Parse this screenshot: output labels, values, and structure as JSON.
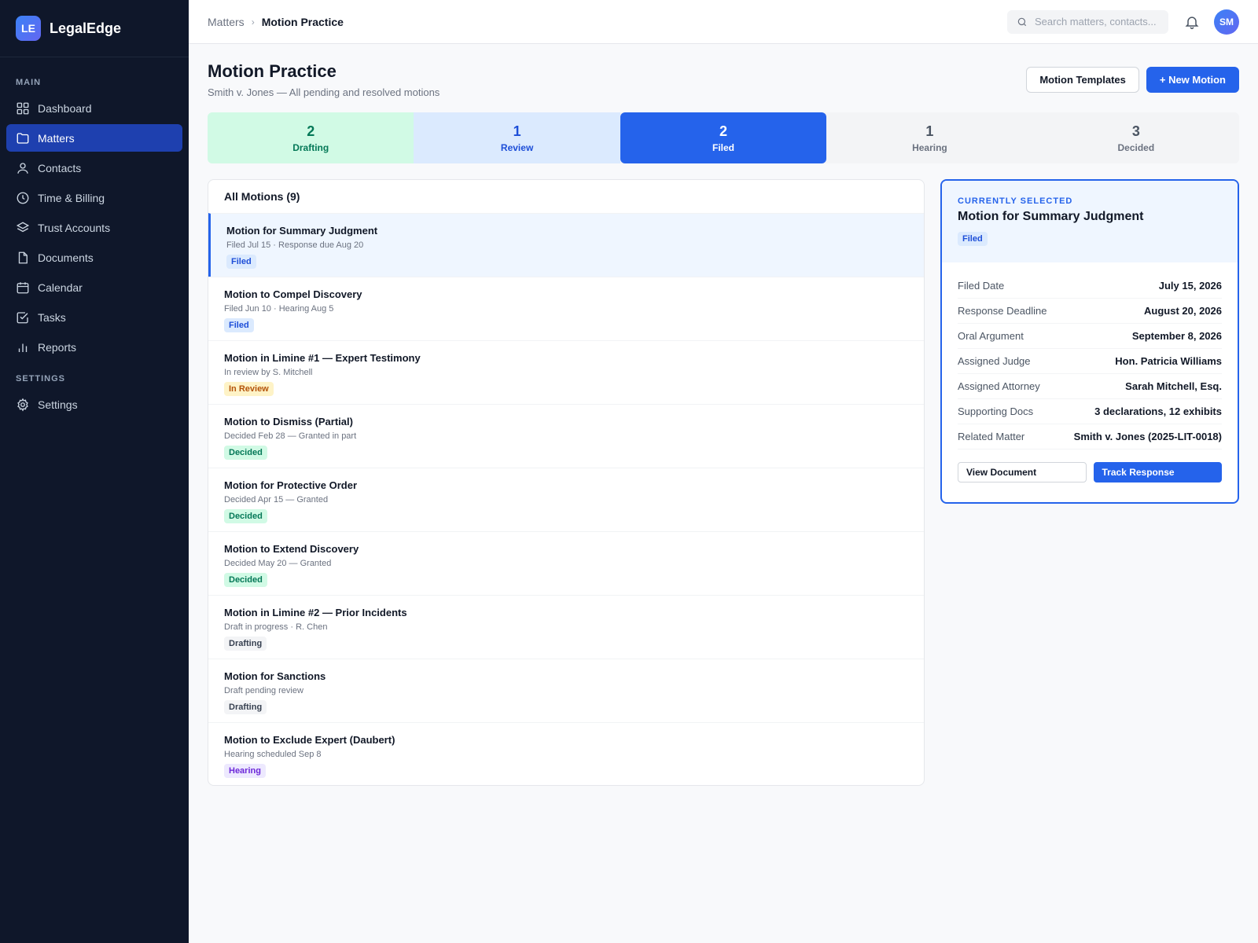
{
  "brand": {
    "logo": "LE",
    "name": "LegalEdge"
  },
  "sidebar": {
    "main_label": "MAIN",
    "items": [
      {
        "label": "Dashboard",
        "icon": "dashboard-icon"
      },
      {
        "label": "Matters",
        "icon": "folder-icon",
        "active": true
      },
      {
        "label": "Contacts",
        "icon": "user-icon"
      },
      {
        "label": "Time & Billing",
        "icon": "clock-icon"
      },
      {
        "label": "Trust Accounts",
        "icon": "layers-icon"
      },
      {
        "label": "Documents",
        "icon": "document-icon"
      },
      {
        "label": "Calendar",
        "icon": "calendar-icon"
      },
      {
        "label": "Tasks",
        "icon": "checkbox-icon"
      },
      {
        "label": "Reports",
        "icon": "bar-chart-icon"
      }
    ],
    "settings_label": "SETTINGS",
    "settings_item": {
      "label": "Settings",
      "icon": "gear-icon"
    }
  },
  "topbar": {
    "breadcrumb_parent": "Matters",
    "breadcrumb_current": "Motion Practice",
    "search_placeholder": "Search matters, contacts...",
    "avatar_initials": "SM"
  },
  "page": {
    "title": "Motion Practice",
    "subtitle": "Smith v. Jones — All pending and resolved motions",
    "templates_button": "Motion Templates",
    "new_button": "+ New Motion"
  },
  "stages": [
    {
      "count": "2",
      "label": "Drafting"
    },
    {
      "count": "1",
      "label": "Review"
    },
    {
      "count": "2",
      "label": "Filed",
      "selected": true
    },
    {
      "count": "1",
      "label": "Hearing"
    },
    {
      "count": "3",
      "label": "Decided"
    }
  ],
  "list": {
    "heading": "All Motions (9)",
    "motions": [
      {
        "title": "Motion for Summary Judgment",
        "detail": "Filed Jul 15 · Response due Aug 20",
        "status": "Filed",
        "selected": true
      },
      {
        "title": "Motion to Compel Discovery",
        "detail": "Filed Jun 10 · Hearing Aug 5",
        "status": "Filed"
      },
      {
        "title": "Motion in Limine #1 — Expert Testimony",
        "detail": "In review by S. Mitchell",
        "status": "In Review"
      },
      {
        "title": "Motion to Dismiss (Partial)",
        "detail": "Decided Feb 28 — Granted in part",
        "status": "Decided"
      },
      {
        "title": "Motion for Protective Order",
        "detail": "Decided Apr 15 — Granted",
        "status": "Decided"
      },
      {
        "title": "Motion to Extend Discovery",
        "detail": "Decided May 20 — Granted",
        "status": "Decided"
      },
      {
        "title": "Motion in Limine #2 — Prior Incidents",
        "detail": "Draft in progress · R. Chen",
        "status": "Drafting"
      },
      {
        "title": "Motion for Sanctions",
        "detail": "Draft pending review",
        "status": "Drafting"
      },
      {
        "title": "Motion to Exclude Expert (Daubert)",
        "detail": "Hearing scheduled Sep 8",
        "status": "Hearing"
      }
    ]
  },
  "detail": {
    "eyebrow": "CURRENTLY SELECTED",
    "title": "Motion for Summary Judgment",
    "status": "Filed",
    "rows": [
      {
        "key": "Filed Date",
        "value": "July 15, 2026"
      },
      {
        "key": "Response Deadline",
        "value": "August 20, 2026"
      },
      {
        "key": "Oral Argument",
        "value": "September 8, 2026"
      },
      {
        "key": "Assigned Judge",
        "value": "Hon. Patricia Williams"
      },
      {
        "key": "Assigned Attorney",
        "value": "Sarah Mitchell, Esq."
      },
      {
        "key": "Supporting Docs",
        "value": "3 declarations, 12 exhibits"
      },
      {
        "key": "Related Matter",
        "value": "Smith v. Jones (2025-LIT-0018)"
      }
    ],
    "view_button": "View Document",
    "track_button": "Track Response"
  },
  "colors": {
    "accent": "#2563eb",
    "sidebar": "#0f172a",
    "active_nav": "#1e40af"
  }
}
